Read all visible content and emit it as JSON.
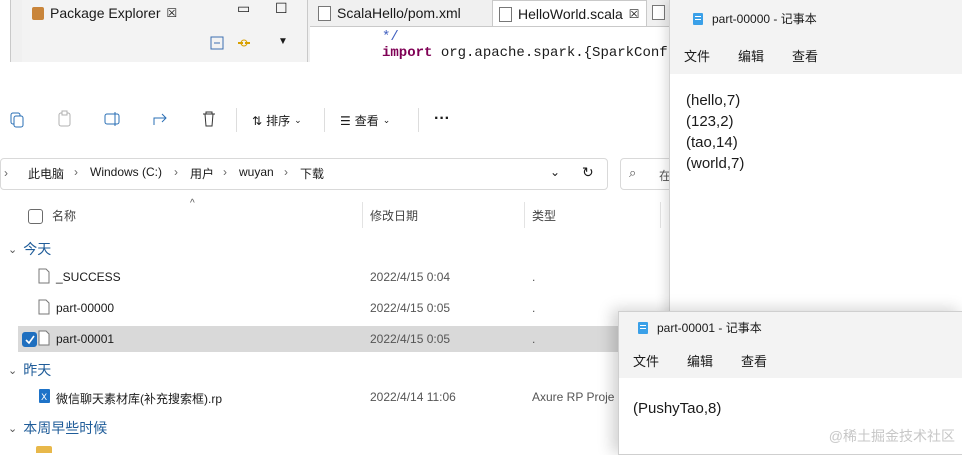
{
  "eclipse": {
    "tabs": [
      {
        "label": "Package Explorer",
        "close": "☒"
      },
      {
        "label": "ScalaHello/pom.xml"
      },
      {
        "label": "HelloWorld.scala",
        "close": "☒"
      }
    ],
    "code": {
      "comment": "*/",
      "import_keyword": "import",
      "import_rest": " org.apache.spark.{SparkConf,"
    }
  },
  "explorer": {
    "toolbar": {
      "sort_label": "排序",
      "view_label": "查看",
      "more": "···"
    },
    "breadcrumb": [
      "此电脑",
      "Windows (C:)",
      "用户",
      "wuyan",
      "下载"
    ],
    "search_placeholder": "在",
    "columns": {
      "name": "名称",
      "date": "修改日期",
      "type": "类型"
    },
    "groups": [
      {
        "label": "今天",
        "files": [
          {
            "name": "_SUCCESS",
            "date": "2022/4/15 0:04",
            "type": ".",
            "selected": false
          },
          {
            "name": "part-00000",
            "date": "2022/4/15 0:05",
            "type": ".",
            "selected": false
          },
          {
            "name": "part-00001",
            "date": "2022/4/15 0:05",
            "type": ".",
            "selected": true
          }
        ]
      },
      {
        "label": "昨天",
        "files": [
          {
            "name": "微信聊天素材库(补充搜索框).rp",
            "date": "2022/4/14 11:06",
            "type": "Axure RP Proje",
            "selected": false
          }
        ]
      },
      {
        "label": "本周早些时候",
        "files": []
      }
    ]
  },
  "notepad1": {
    "title": "part-00000 - 记事本",
    "menu": [
      "文件",
      "编辑",
      "查看"
    ],
    "lines": [
      "(hello,7)",
      "(123,2)",
      "(tao,14)",
      "(world,7)"
    ]
  },
  "notepad2": {
    "title": "part-00001 - 记事本",
    "menu": [
      "文件",
      "编辑",
      "查看"
    ],
    "lines": [
      "(PushyTao,8)"
    ],
    "watermark": "@稀土掘金技术社区"
  },
  "colors": {
    "accent": "#1f6fbf",
    "group_text": "#1f5c99",
    "selection": "#d9d9d9"
  }
}
